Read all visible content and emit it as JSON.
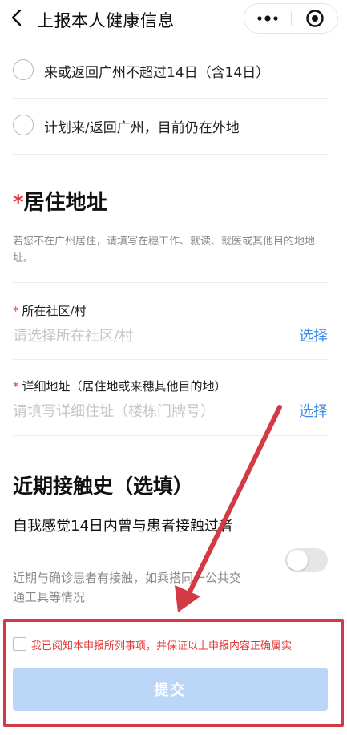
{
  "header": {
    "title": "上报本人健康信息",
    "back_icon": "chevron-left-icon",
    "more_icon": "more-dots-icon",
    "target_icon": "target-icon"
  },
  "options": [
    {
      "label": "来或返回广州不超过14日（含14日）"
    },
    {
      "label": "计划来/返回广州，目前仍在外地"
    }
  ],
  "address": {
    "star": "*",
    "title": "居住地址",
    "hint": "若您不在广州居住，请填写在穗工作、就读、就医或其他目的地地址。",
    "community": {
      "req": "*",
      "label": "所在社区/村",
      "placeholder": "请选择所在社区/村",
      "action": "选择"
    },
    "detail": {
      "req": "*",
      "label": "详细地址（居住地或来穗其他目的地）",
      "placeholder": "请填写详细住址（楼栋门牌号）",
      "action": "选择"
    }
  },
  "contact": {
    "title": "近期接触史（选填）",
    "question": "自我感觉14日内曾与患者接触过者",
    "description": "近期与确诊患者有接触，如乘搭同一公共交通工具等情况",
    "toggle_on": false
  },
  "agreement": {
    "text": "我已阅知本申报所列事项，并保证以上申报内容正确属实",
    "checked": false
  },
  "submit_label": "提交",
  "colors": {
    "accent": "#3d8be8",
    "required": "#e5393a",
    "highlight": "#d43a45",
    "button_disabled": "#bcd6f7"
  }
}
